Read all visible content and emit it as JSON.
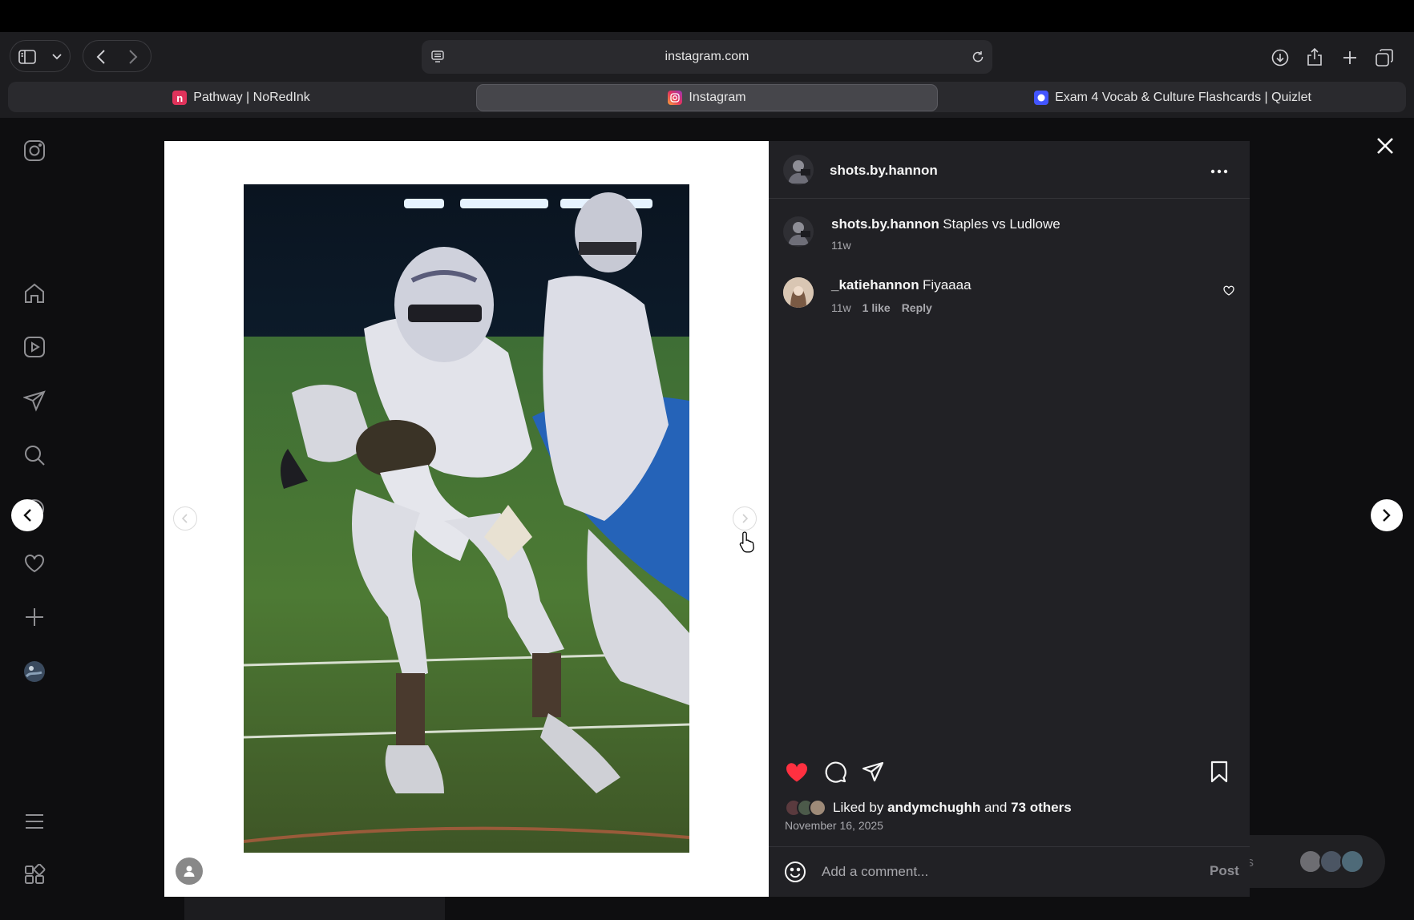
{
  "browser": {
    "url": "instagram.com",
    "tabs": [
      {
        "label": "Pathway | NoRedInk",
        "favicon": "noredink-icon"
      },
      {
        "label": "Instagram",
        "favicon": "instagram-icon",
        "active": true
      },
      {
        "label": "Exam 4 Vocab & Culture Flashcards | Quizlet",
        "favicon": "quizlet-icon"
      }
    ]
  },
  "post": {
    "author": "shots.by.hannon",
    "caption": {
      "username": "shots.by.hannon",
      "text": "Staples vs Ludlowe",
      "age": "11w"
    },
    "comments": [
      {
        "username": "_katiehannon",
        "text": "Fiyaaaa",
        "age": "11w",
        "likes": "1 like",
        "reply_label": "Reply"
      }
    ],
    "liked_by_prefix": "Liked by",
    "liked_by_user": "andymchughh",
    "liked_by_and": "and",
    "liked_by_others": "73 others",
    "date": "November 16, 2025",
    "comment_placeholder": "Add a comment...",
    "post_label": "Post",
    "liked": true
  },
  "background": {
    "pill_text": "es"
  },
  "colors": {
    "like_red": "#ff3040",
    "panel_bg": "#212125",
    "page_bg": "#0e0e10"
  }
}
